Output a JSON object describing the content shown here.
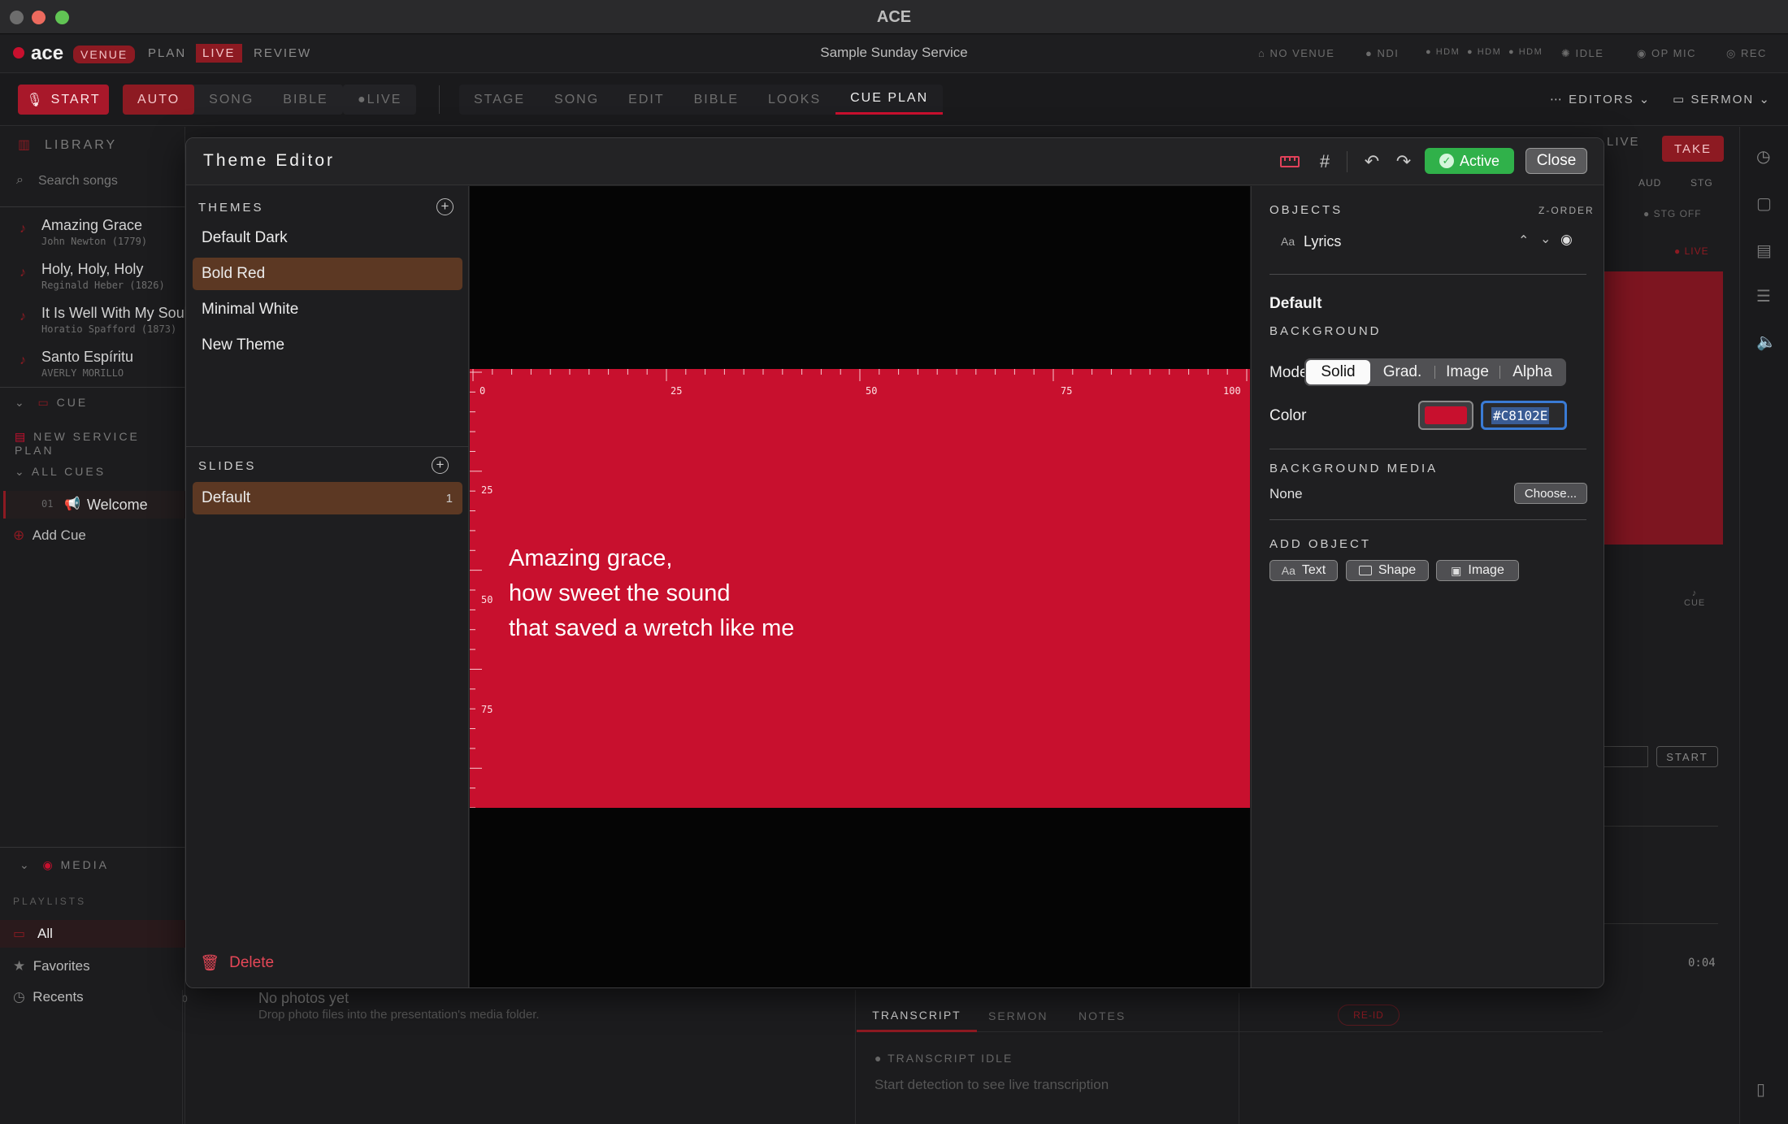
{
  "window": {
    "title": "ACE"
  },
  "header": {
    "logo": "ace",
    "venue_pill": "VENUE",
    "tabs": [
      "PLAN",
      "LIVE",
      "REVIEW"
    ],
    "service_name": "Sample Sunday Service",
    "status": [
      "NO VENUE",
      "NDI",
      "HDM",
      "HDM",
      "HDM",
      "IDLE",
      "OP MIC",
      "REC"
    ]
  },
  "toolbar": {
    "start_label": "START",
    "mode_tabs": [
      "AUTO",
      "SONG",
      "BIBLE"
    ],
    "live_label": "LIVE",
    "view_tabs": [
      "STAGE",
      "SONG",
      "EDIT",
      "BIBLE",
      "LOOKS",
      "CUE PLAN"
    ],
    "editors_label": "EDITORS",
    "sermon_label": "SERMON"
  },
  "library": {
    "title": "LIBRARY",
    "search_placeholder": "Search songs",
    "songs": [
      {
        "title": "Amazing Grace",
        "author": "John Newton (1779)"
      },
      {
        "title": "Holy, Holy, Holy",
        "author": "Reginald Heber (1826)"
      },
      {
        "title": "It Is Well With My Soul",
        "author": "Horatio Spafford (1873)"
      },
      {
        "title": "Santo Espíritu",
        "author": "AVERLY MORILLO"
      }
    ],
    "cue_label": "CUE",
    "new_service_plan": "NEW SERVICE PLAN",
    "all_cues": "ALL CUES",
    "cues": [
      {
        "num": "01",
        "title": "Welcome"
      }
    ],
    "add_cue": "Add Cue",
    "media_label": "MEDIA",
    "playlists_label": "PLAYLISTS",
    "playlists": [
      "All",
      "Favorites",
      "Recents"
    ]
  },
  "bottom": {
    "no_photos": "No photos yet",
    "no_photos_hint": "Drop photo files into the presentation's media folder.",
    "count": "0",
    "tabs": [
      "TRANSCRIPT",
      "SERMON",
      "NOTES"
    ],
    "reid": "RE-ID",
    "transcript_status": "TRANSCRIPT IDLE",
    "transcript_hint": "Start detection to see live transcription",
    "time": "0:04"
  },
  "right_panel": {
    "live": "LIVE",
    "take": "TAKE",
    "aud": "AUD",
    "stg": "STG",
    "stg_off": "STG OFF",
    "live_tag": "LIVE",
    "cue": "CUE",
    "start": "START"
  },
  "theme_editor": {
    "title": "Theme Editor",
    "active_label": "Active",
    "close_label": "Close",
    "themes_label": "THEMES",
    "themes": [
      "Default Dark",
      "Bold Red",
      "Minimal White",
      "New Theme"
    ],
    "selected_theme": "Bold Red",
    "slides_label": "SLIDES",
    "slides": [
      {
        "name": "Default",
        "count": "1"
      }
    ],
    "delete_label": "Delete",
    "canvas": {
      "ruler_h": [
        "0",
        "25",
        "50",
        "75",
        "100"
      ],
      "ruler_v": [
        "25",
        "50",
        "75"
      ],
      "lyrics": [
        "Amazing grace,",
        "how sweet the sound",
        "that saved a wretch like me"
      ]
    },
    "objects_label": "OBJECTS",
    "zorder_label": "Z-ORDER",
    "objects": [
      {
        "type": "Aa",
        "name": "Lyrics"
      }
    ],
    "section_title": "Default",
    "background_label": "BACKGROUND",
    "mode_label": "Mode",
    "modes": [
      "Solid",
      "Grad.",
      "Image",
      "Alpha"
    ],
    "selected_mode": "Solid",
    "color_label": "Color",
    "color_value": "#C8102E",
    "background_media_label": "BACKGROUND MEDIA",
    "background_media_value": "None",
    "choose_label": "Choose...",
    "add_object_label": "ADD OBJECT",
    "add_buttons": [
      "Text",
      "Shape",
      "Image"
    ]
  },
  "colors": {
    "accent_red": "#c8102e",
    "active_green": "#30b14a",
    "selection_brown": "#5c3823"
  }
}
